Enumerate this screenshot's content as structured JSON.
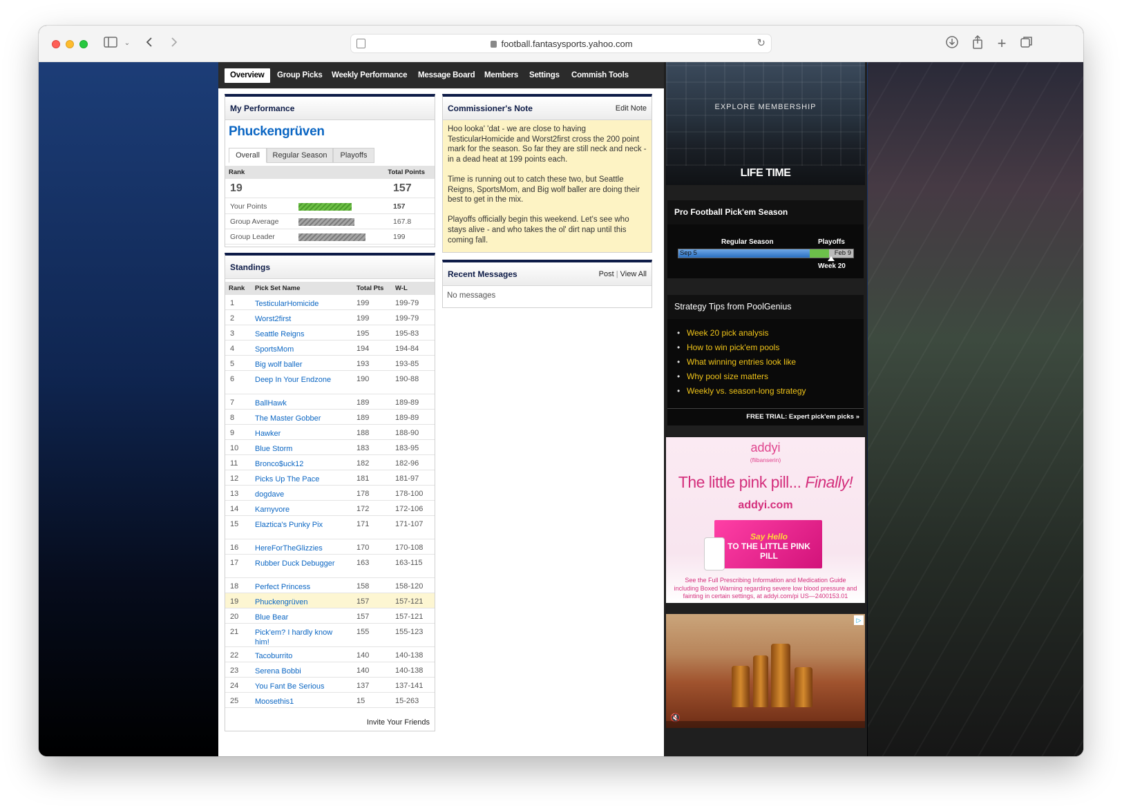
{
  "browser": {
    "url": "football.fantasysports.yahoo.com"
  },
  "nav": {
    "items": [
      "Overview",
      "Group Picks",
      "Weekly Performance",
      "Message Board",
      "Members",
      "Settings",
      "Commish Tools"
    ],
    "active": "Overview"
  },
  "my_performance": {
    "title": "My Performance",
    "team_name": "Phuckengrüven",
    "tabs": [
      "Overall",
      "Regular Season",
      "Playoffs"
    ],
    "active_tab": "Overall",
    "rank_label": "Rank",
    "total_points_label": "Total Points",
    "rank": "19",
    "total_points": "157",
    "rows": [
      {
        "label": "Your Points",
        "value": "157",
        "fraction": 0.79
      },
      {
        "label": "Group Average",
        "value": "167.8",
        "fraction": 0.84
      },
      {
        "label": "Group Leader",
        "value": "199",
        "fraction": 1.0
      }
    ]
  },
  "standings": {
    "title": "Standings",
    "columns": [
      "Rank",
      "Pick Set Name",
      "Total Pts",
      "W-L"
    ],
    "rows": [
      {
        "rank": "1",
        "name": "TesticularHomicide",
        "pts": "199",
        "wl": "199-79"
      },
      {
        "rank": "2",
        "name": "Worst2first",
        "pts": "199",
        "wl": "199-79"
      },
      {
        "rank": "3",
        "name": "Seattle Reigns",
        "pts": "195",
        "wl": "195-83"
      },
      {
        "rank": "4",
        "name": "SportsMom",
        "pts": "194",
        "wl": "194-84"
      },
      {
        "rank": "5",
        "name": "Big wolf baller",
        "pts": "193",
        "wl": "193-85"
      },
      {
        "rank": "6",
        "name": "Deep In Your Endzone",
        "pts": "190",
        "wl": "190-88"
      },
      {
        "rank": "7",
        "name": "BallHawk",
        "pts": "189",
        "wl": "189-89"
      },
      {
        "rank": "8",
        "name": "The Master Gobber",
        "pts": "189",
        "wl": "189-89"
      },
      {
        "rank": "9",
        "name": "Hawker",
        "pts": "188",
        "wl": "188-90"
      },
      {
        "rank": "10",
        "name": "Blue Storm",
        "pts": "183",
        "wl": "183-95"
      },
      {
        "rank": "11",
        "name": "Bronco$uck12",
        "pts": "182",
        "wl": "182-96"
      },
      {
        "rank": "12",
        "name": "Picks Up The Pace",
        "pts": "181",
        "wl": "181-97"
      },
      {
        "rank": "13",
        "name": "dogdave",
        "pts": "178",
        "wl": "178-100"
      },
      {
        "rank": "14",
        "name": "Karnyvore",
        "pts": "172",
        "wl": "172-106"
      },
      {
        "rank": "15",
        "name": "Elaztica's Punky Pix",
        "pts": "171",
        "wl": "171-107"
      },
      {
        "rank": "16",
        "name": "HereForTheGlizzies",
        "pts": "170",
        "wl": "170-108"
      },
      {
        "rank": "17",
        "name": "Rubber Duck Debugger",
        "pts": "163",
        "wl": "163-115"
      },
      {
        "rank": "18",
        "name": "Perfect Princess",
        "pts": "158",
        "wl": "158-120"
      },
      {
        "rank": "19",
        "name": "Phuckengrüven",
        "pts": "157",
        "wl": "157-121"
      },
      {
        "rank": "20",
        "name": "Blue Bear",
        "pts": "157",
        "wl": "157-121"
      },
      {
        "rank": "21",
        "name": "Pick'em? I hardly know him!",
        "pts": "155",
        "wl": "155-123"
      },
      {
        "rank": "22",
        "name": "Tacoburrito",
        "pts": "140",
        "wl": "140-138"
      },
      {
        "rank": "23",
        "name": "Serena Bobbi",
        "pts": "140",
        "wl": "140-138"
      },
      {
        "rank": "24",
        "name": "You Fant Be Serious",
        "pts": "137",
        "wl": "137-141"
      },
      {
        "rank": "25",
        "name": "Moosethis1",
        "pts": "15",
        "wl": "15-263"
      }
    ],
    "highlight_rank": "19",
    "invite_label": "Invite Your Friends"
  },
  "commissioner_note": {
    "title": "Commissioner's Note",
    "edit_label": "Edit Note",
    "paragraphs": [
      "Hoo looka' 'dat - we are close to having TesticularHomicide and Worst2first cross the 200 point mark for the season. So far they are still neck and neck - in a dead heat at 199 points each.",
      "Time is running out to catch these two, but Seattle Reigns, SportsMom, and Big wolf baller are doing their best to get in the mix.",
      "Playoffs officially begin this weekend. Let's see who stays alive - and who takes the ol' dirt nap until this coming fall."
    ]
  },
  "recent_messages": {
    "title": "Recent Messages",
    "post_label": "Post",
    "separator": "|",
    "view_all_label": "View All",
    "empty_text": "No messages"
  },
  "sidebar": {
    "ad_top": {
      "tagline": "EXPLORE MEMBERSHIP",
      "brand": "LIFE TIME"
    },
    "season": {
      "title": "Pro Football Pick'em Season",
      "regular_label": "Regular Season",
      "playoffs_label": "Playoffs",
      "start_date": "Sep 5",
      "end_date": "Feb 9",
      "current_week": "Week 20"
    },
    "tips": {
      "title": "Strategy Tips from PoolGenius",
      "items": [
        "Week 20 pick analysis",
        "How to win pick'em pools",
        "What winning entries look like",
        "Why pool size matters",
        "Weekly vs. season-long strategy"
      ],
      "trial_label": "FREE TRIAL: Expert pick'em picks »"
    },
    "ad_pink": {
      "logo": "addyi",
      "logo_sub": "(flibanserin)",
      "headline_a": "The little pink pill... ",
      "headline_b": "Finally!",
      "site": "addyi.com",
      "package_text_a": "Say Hello",
      "package_text_b": "TO THE LITTLE PINK PILL",
      "fine_print": "See the Full Prescribing Information and Medication Guide including Boxed Warning regarding severe low blood pressure and fainting in certain settings, at addyi.com/pi  US—2400153.01"
    }
  },
  "colors": {
    "nav_bg": "#2b2b2b",
    "panel_accent": "#0d1b47",
    "link": "#0b66c3",
    "note_bg": "#fdf3c4",
    "highlight_row": "#fdf6d2",
    "tip_link": "#f0c419"
  }
}
